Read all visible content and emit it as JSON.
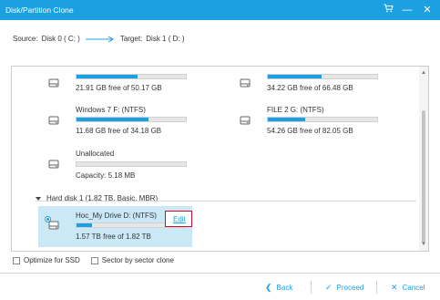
{
  "titlebar": {
    "title": "Disk/Partition Clone",
    "icons": [
      "cart-icon",
      "minimize-icon",
      "close-icon"
    ]
  },
  "source_target": {
    "source_label": "Source:",
    "source_value": "Disk 0 ( C: )",
    "target_label": "Target:",
    "target_value": "Disk 1 ( D: )"
  },
  "partitions": [
    {
      "name": "",
      "free": "21.91 GB free of 50.17 GB",
      "fill": 0.56
    },
    {
      "name": "",
      "free": "34.22 GB free of 66.48 GB",
      "fill": 0.49
    },
    {
      "name": "Windows 7 F: (NTFS)",
      "free": "11.68 GB free of 34.18 GB",
      "fill": 0.66
    },
    {
      "name": "FILE 2 G: (NTFS)",
      "free": "54.26 GB free of 82.05 GB",
      "fill": 0.34
    },
    {
      "name": "Unallocated",
      "free": "Capacity: 5.18 MB",
      "fill": 0.0
    }
  ],
  "hard_disk_1": {
    "header": "Hard disk 1 (1.82 TB, Basic, MBR)",
    "partition": {
      "name": "Hoc_My Drive D: (NTFS)",
      "free": "1.57 TB free of 1.82 TB",
      "fill": 0.14,
      "edit_label": "Edit"
    }
  },
  "options": {
    "optimize_ssd": "Optimize for SSD",
    "sector_clone": "Sector by sector clone"
  },
  "footer": {
    "back": "Back",
    "proceed": "Proceed",
    "cancel": "Cancel"
  },
  "colors": {
    "accent": "#1ba1e2",
    "selected_row": "#cbe8f7",
    "highlight_box": "#c8102e"
  }
}
